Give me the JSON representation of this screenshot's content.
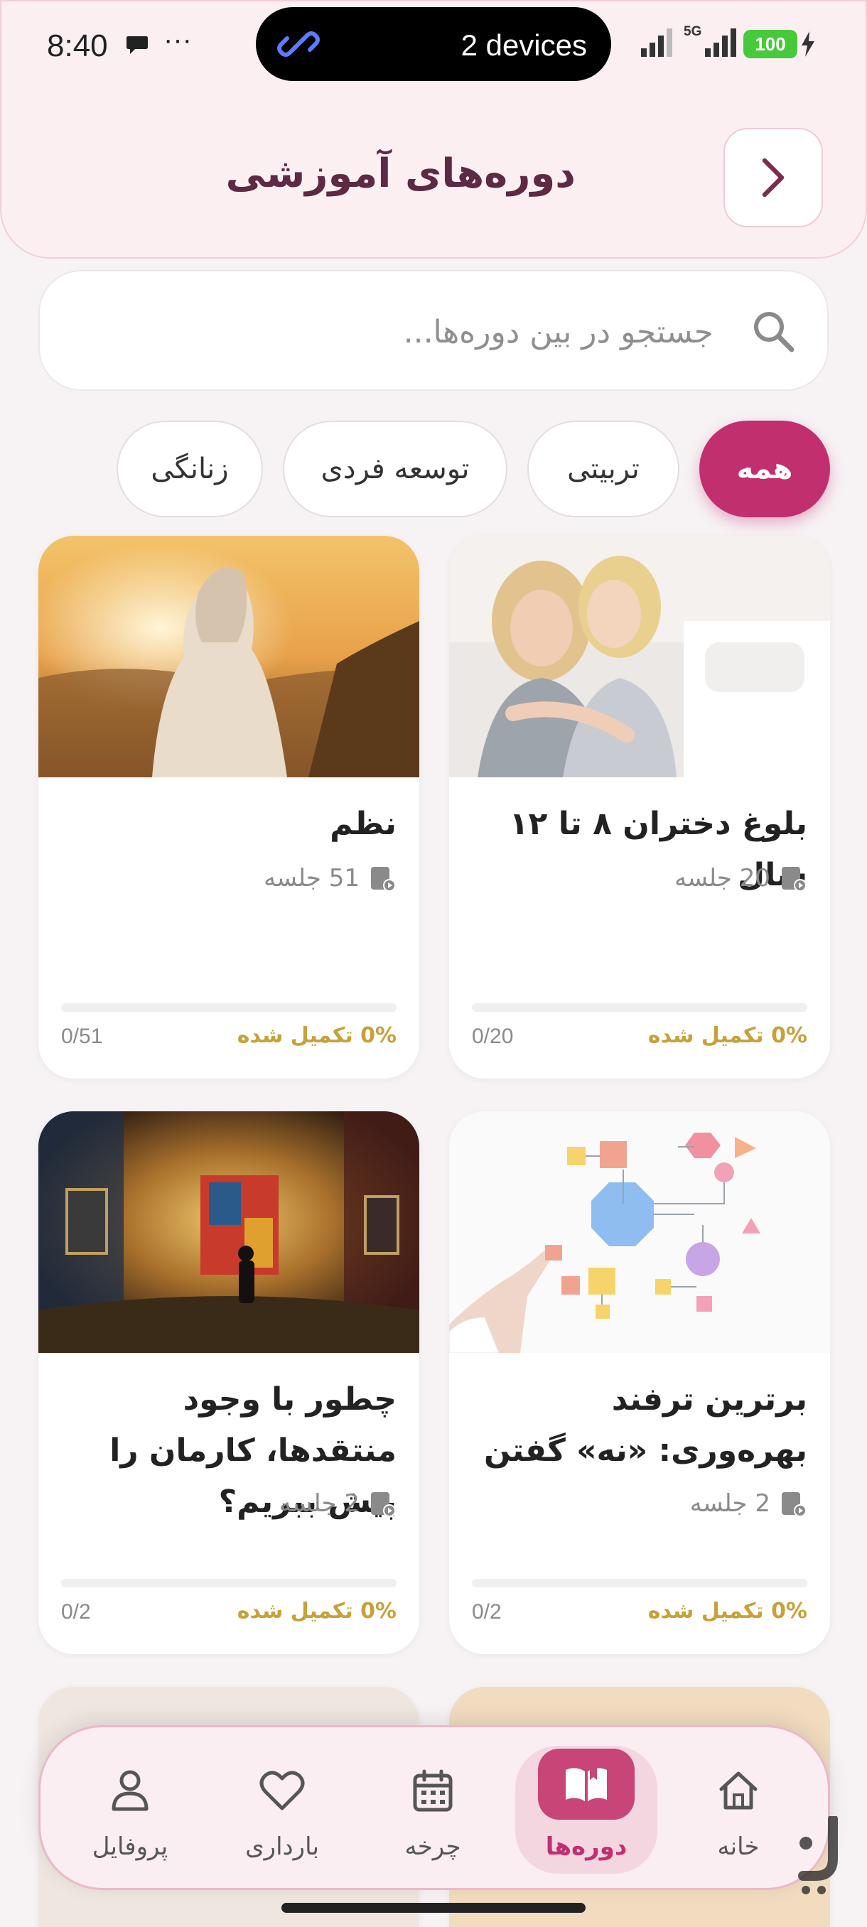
{
  "status_bar": {
    "time": "8:40",
    "dots": "···",
    "pill_text": "2 devices",
    "network": "5G",
    "battery": "100"
  },
  "header": {
    "title": "دوره‌های آموزشی",
    "back_icon": "chevron-right-icon"
  },
  "search": {
    "placeholder": "جستجو در بین دوره‌ها...",
    "value": "",
    "icon": "search-icon"
  },
  "categories": [
    {
      "label": "همه",
      "active": true
    },
    {
      "label": "تربیتی",
      "active": false
    },
    {
      "label": "توسعه فردی",
      "active": false
    },
    {
      "label": "زنانگی",
      "active": false
    }
  ],
  "courses": [
    {
      "title": "بلوغ دختران ۸ تا ۱۲ سال",
      "sessions": "20 جلسه",
      "completed": "0% تکمیل شده",
      "count": "0/20",
      "progress": 0
    },
    {
      "title": "نظم",
      "sessions": "51 جلسه",
      "completed": "0% تکمیل شده",
      "count": "0/51",
      "progress": 0
    },
    {
      "title": "برترین ترفند بهره‌وری: «نه» گفتن",
      "sessions": "2 جلسه",
      "completed": "0% تکمیل شده",
      "count": "0/2",
      "progress": 0
    },
    {
      "title": "چطور با وجود منتقدها، کارمان را پیش ببریم؟",
      "sessions": "2 جلسه",
      "completed": "0% تکمیل شده",
      "count": "0/2",
      "progress": 0
    }
  ],
  "bottom_nav": [
    {
      "label": "خانه",
      "icon": "home-icon",
      "active": false
    },
    {
      "label": "دوره‌ها",
      "icon": "open-book-icon",
      "active": true
    },
    {
      "label": "چرخه",
      "icon": "calendar-icon",
      "active": false
    },
    {
      "label": "بارداری",
      "icon": "heart-icon",
      "active": false
    },
    {
      "label": "پروفایل",
      "icon": "user-icon",
      "active": false
    }
  ],
  "colors": {
    "accent": "#c22f6e",
    "header_bg": "#fbeff2",
    "progress_label": "#c9a13a",
    "title": "#5e2942"
  }
}
